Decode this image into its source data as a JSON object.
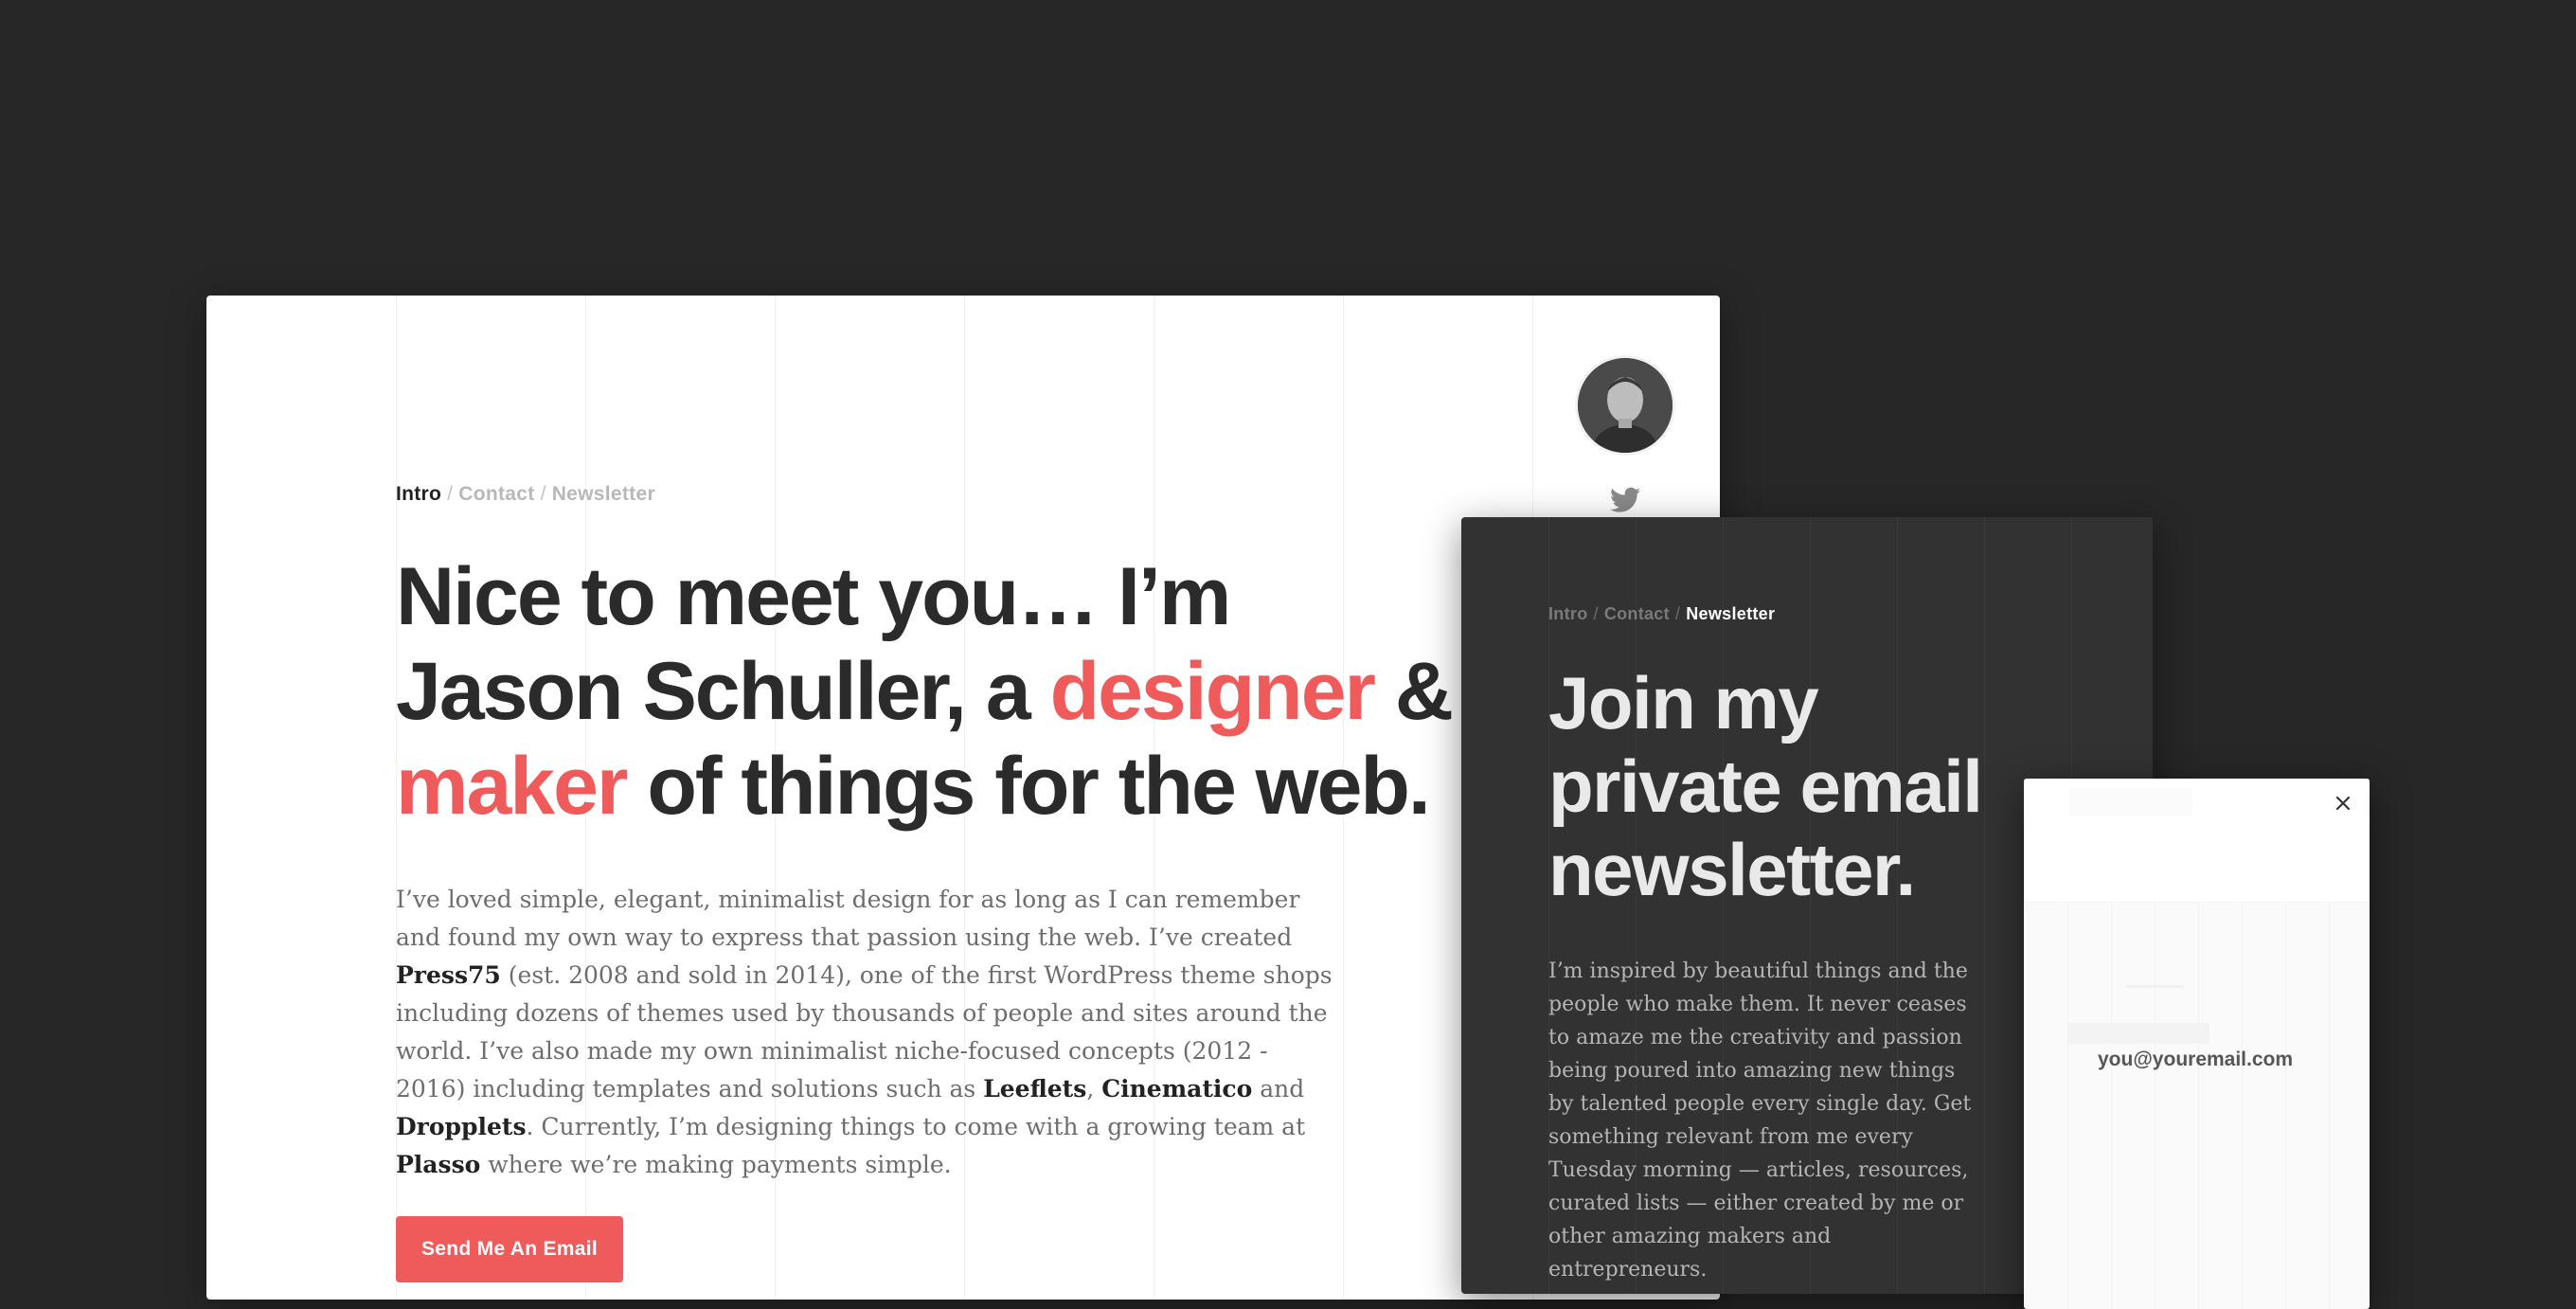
{
  "main_card": {
    "nav": {
      "active": "Intro",
      "items": [
        "Contact",
        "Newsletter"
      ],
      "separator": "/"
    },
    "headline": {
      "line1": "Nice to meet you… I’m",
      "line2_a": "Jason Schuller, a ",
      "line2_accent": "designer",
      "line2_b": " &",
      "line3_accent": "maker",
      "line3_b": " of things for the web."
    },
    "bio": {
      "t1": "I’ve loved simple, elegant, minimalist design for as long as I can remember and found my own way to express that passion using the web. I’ve created ",
      "b1": "Press75",
      "t2": " (est. 2008 and sold in 2014), one of the first WordPress theme shops including dozens of themes used by thousands of people and sites around the world. I’ve also made my own minimalist niche-focused concepts (2012 - 2016) including templates and solutions such as ",
      "b2": "Leeflets",
      "t3": ", ",
      "b3": "Cinematico",
      "t4": " and ",
      "b4": "Dropplets",
      "t5": ". Currently, I’m designing things to come with a growing team at ",
      "b5": "Plasso",
      "t6": " where we’re making payments simple."
    },
    "cta_button": "Send Me An Email",
    "social_icon": "twitter-icon"
  },
  "newsletter_card": {
    "nav": {
      "items": [
        "Intro",
        "Contact"
      ],
      "active": "Newsletter",
      "separator": "/"
    },
    "headline": {
      "line1": "Join my",
      "line2": "private email",
      "line3": "newsletter."
    },
    "body": "I’m inspired by beautiful things and the people who make them. It never ceases to amaze me the creativity and passion being poured into amazing new things by talented people every single day. Get something relevant from me every Tuesday morning — articles, resources, curated lists — either created by me or other amazing makers and entrepreneurs."
  },
  "signup_modal": {
    "email_placeholder": "you@youremail.com",
    "close_icon": "close-icon"
  },
  "colors": {
    "background": "#272727",
    "accent": "#ef5a5a",
    "dark_card": "#323232",
    "text_dark": "#2b2b2b"
  }
}
